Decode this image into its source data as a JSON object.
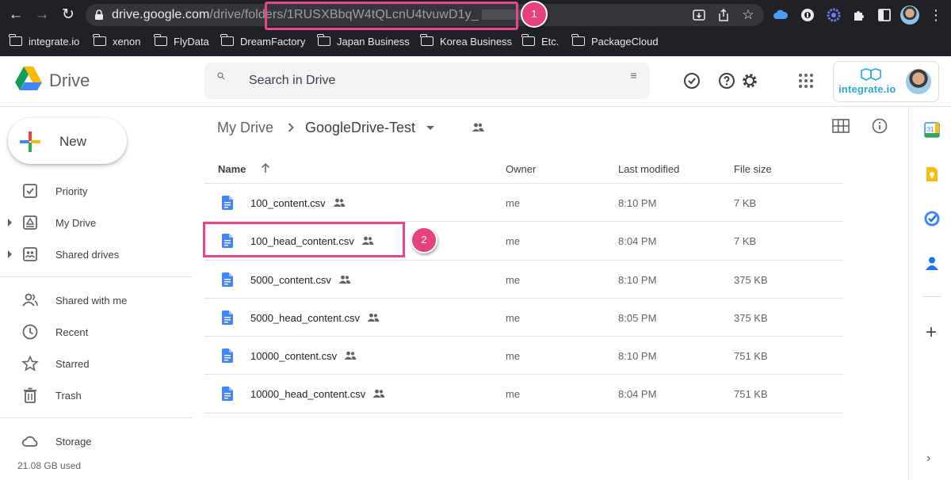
{
  "browser": {
    "url_host": "drive.google.com",
    "url_path": "/drive/folders/1RUSXBbqW4tQLcnU4tvuwD1y_",
    "bookmarks": [
      "integrate.io",
      "xenon",
      "FlyData",
      "DreamFactory",
      "Japan Business",
      "Korea Business",
      "Etc.",
      "PackageCloud"
    ]
  },
  "callouts": [
    "1",
    "2"
  ],
  "header": {
    "app_name": "Drive",
    "search_placeholder": "Search in Drive",
    "account_org": "integrate.io"
  },
  "sidebar": {
    "new_label": "New",
    "items": [
      {
        "label": "Priority",
        "icon": "priority-checkbox-icon"
      },
      {
        "label": "My Drive",
        "icon": "my-drive-icon"
      },
      {
        "label": "Shared drives",
        "icon": "shared-drives-icon"
      },
      {
        "label": "Shared with me",
        "icon": "shared-with-me-icon"
      },
      {
        "label": "Recent",
        "icon": "clock-icon"
      },
      {
        "label": "Starred",
        "icon": "star-icon"
      },
      {
        "label": "Trash",
        "icon": "trash-icon"
      },
      {
        "label": "Storage",
        "icon": "cloud-icon"
      }
    ],
    "storage_used": "21.08 GB used"
  },
  "main": {
    "breadcrumb_root": "My Drive",
    "breadcrumb_current": "GoogleDrive-Test",
    "columns": {
      "name": "Name",
      "owner": "Owner",
      "modified": "Last modified",
      "size": "File size"
    },
    "files": [
      {
        "name": "100_content.csv",
        "owner": "me",
        "modified": "8:10 PM",
        "size": "7 KB"
      },
      {
        "name": "100_head_content.csv",
        "owner": "me",
        "modified": "8:04 PM",
        "size": "7 KB"
      },
      {
        "name": "5000_content.csv",
        "owner": "me",
        "modified": "8:10 PM",
        "size": "375 KB"
      },
      {
        "name": "5000_head_content.csv",
        "owner": "me",
        "modified": "8:05 PM",
        "size": "375 KB"
      },
      {
        "name": "10000_content.csv",
        "owner": "me",
        "modified": "8:10 PM",
        "size": "751 KB"
      },
      {
        "name": "10000_head_content.csv",
        "owner": "me",
        "modified": "8:04 PM",
        "size": "751 KB"
      }
    ]
  },
  "side_panel": {
    "calendar_day": "31"
  },
  "colors": {
    "chrome_bg": "#202124",
    "callout": "#e8478d",
    "doc_icon": "#4285f4",
    "text_primary": "#3c4043"
  }
}
